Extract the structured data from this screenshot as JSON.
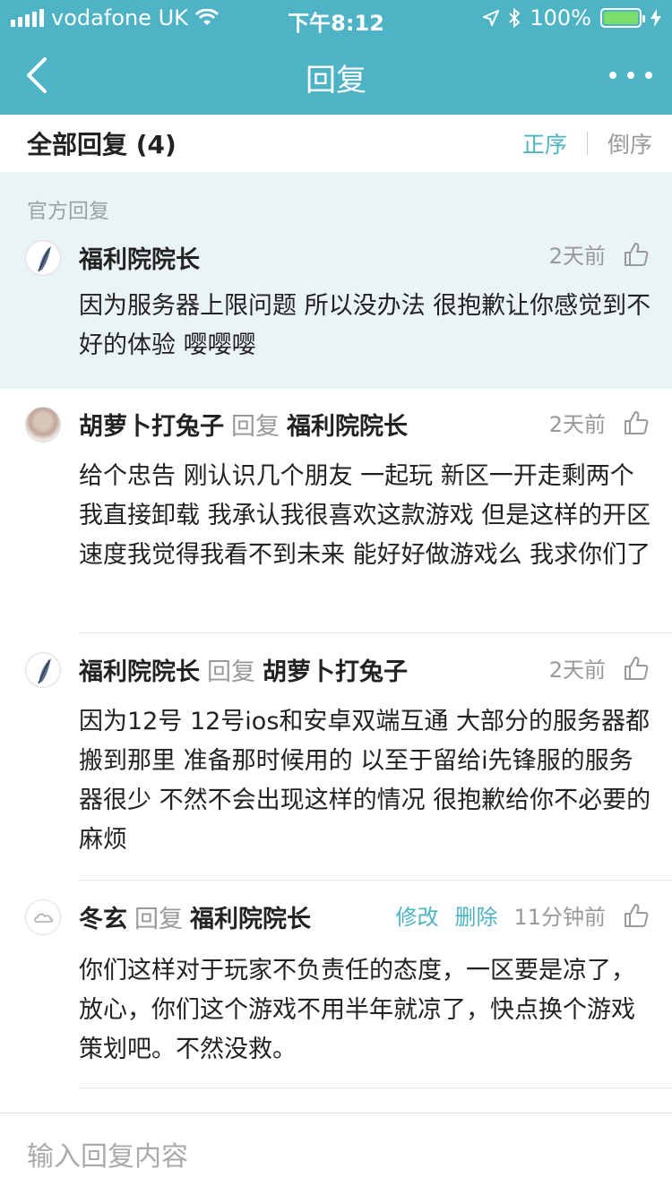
{
  "status_bar": {
    "carrier": "vodafone UK",
    "time": "下午8:12",
    "battery": "100%"
  },
  "nav": {
    "title": "回复"
  },
  "section": {
    "count_label": "全部回复 (4)",
    "sort_asc": "正序",
    "sort_desc": "倒序"
  },
  "official": {
    "label": "官方回复",
    "comment": {
      "author": "福利院院长",
      "time": "2天前",
      "text": "因为服务器上限问题 所以没办法 很抱歉让你感觉到不好的体验 嘤嘤嘤"
    }
  },
  "replies": [
    {
      "author": "胡萝卜打兔子",
      "reply_word": "回复",
      "target": "福利院院长",
      "time": "2天前",
      "text": "给个忠告  刚认识几个朋友  一起玩  新区一开走剩两个  我直接卸载   我承认我很喜欢这款游戏 但是这样的开区速度我觉得我看不到未来  能好好做游戏么  我求你们了"
    },
    {
      "author": "福利院院长",
      "reply_word": "回复",
      "target": "胡萝卜打兔子",
      "time": "2天前",
      "text": "因为12号  12号ios和安卓双端互通 大部分的服务器都搬到那里 准备那时候用的 以至于留给i先锋服的服务器很少 不然不会出现这样的情况 很抱歉给你不必要的麻烦"
    },
    {
      "author": "冬玄",
      "reply_word": "回复",
      "target": "福利院院长",
      "edit": "修改",
      "delete": "删除",
      "time": "11分钟前",
      "text": "你们这样对于玩家不负责任的态度，一区要是凉了，放心，你们这个游戏不用半年就凉了，快点换个游戏策划吧。不然没救。"
    }
  ],
  "input": {
    "placeholder": "输入回复内容"
  },
  "colors": {
    "accent": "#4fb3c6",
    "official_bg": "#eaf3f5"
  }
}
